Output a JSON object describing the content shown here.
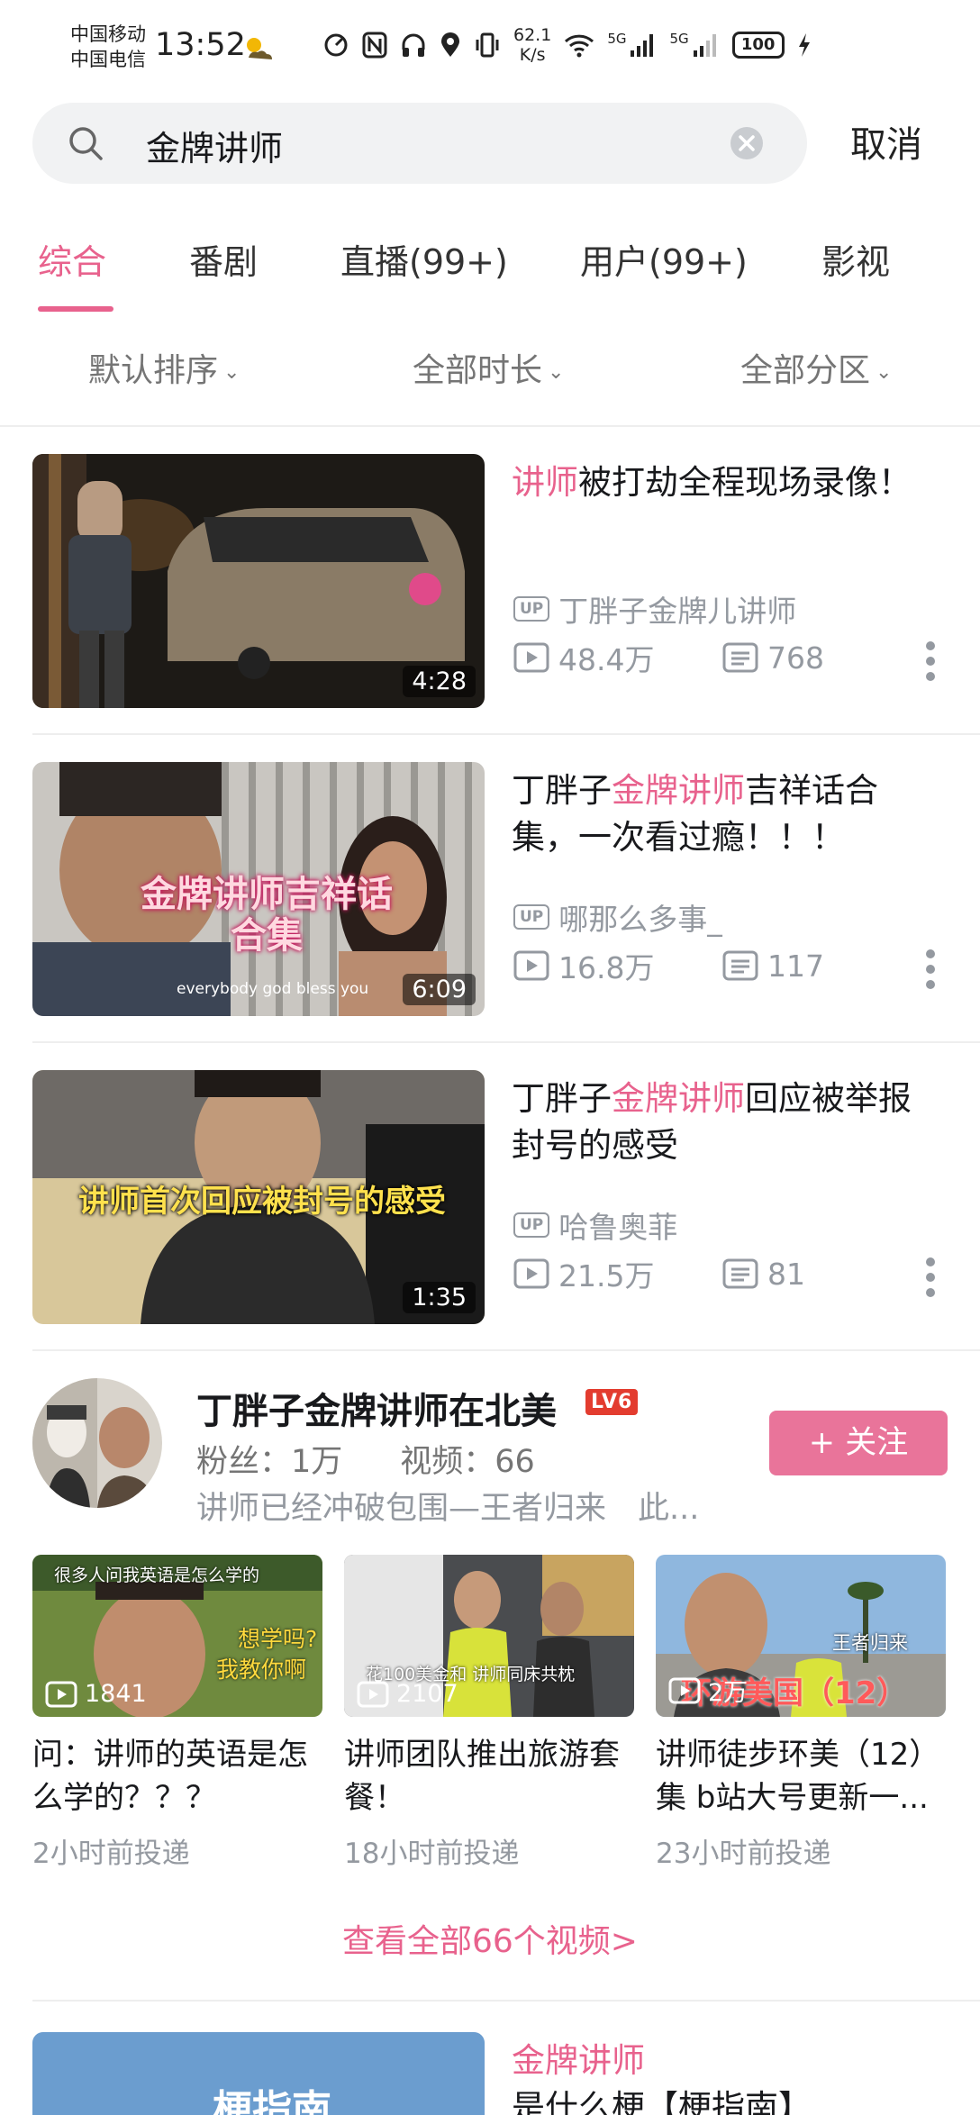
{
  "status_bar": {
    "carrier_1": "中国移动",
    "carrier_2": "中国电信",
    "time": "13:52",
    "net_speed_value": "62.1",
    "net_speed_unit": "K/s",
    "signal_1_label": "5G",
    "signal_2_label": "5G",
    "battery": "100"
  },
  "search": {
    "query": "金牌讲师",
    "cancel_label": "取消"
  },
  "tabs": [
    "综合",
    "番剧",
    "直播(99+)",
    "用户(99+)",
    "影视"
  ],
  "filters": [
    "默认排序",
    "全部时长",
    "全部分区"
  ],
  "videos": [
    {
      "title_hl": "讲师",
      "title_rest": "被打劫全程现场录像！",
      "uploader": "丁胖子金牌儿讲师",
      "plays": "48.4万",
      "comments": "768",
      "duration": "4:28"
    },
    {
      "title_pre": "丁胖子",
      "title_hl": "金牌讲师",
      "title_rest": "吉祥话合集，一次看过瘾！！！",
      "uploader": "哪那么多事_",
      "plays": "16.8万",
      "comments": "117",
      "duration": "6:09",
      "thumb_text": "金牌讲师吉祥话合集",
      "thumb_subtitle": "everybody god bless you"
    },
    {
      "title_pre": "丁胖子",
      "title_hl": "金牌讲师",
      "title_rest": "回应被举报封号的感受",
      "uploader": "哈鲁奥菲",
      "plays": "21.5万",
      "comments": "81",
      "duration": "1:35",
      "thumb_text": "讲师首次回应被封号的感受"
    }
  ],
  "up_badge": "UP",
  "user_card": {
    "name": "丁胖子金牌讲师在北美",
    "level": "LV6",
    "fans_label": "粉丝：1万",
    "videos_label": "视频：66",
    "desc": "讲师已经冲破包围—王者归来　此...",
    "follow_label": "+ 关注",
    "mini_videos": [
      {
        "plays": "1841",
        "title": "问：讲师的英语是怎么学的？？？",
        "time": "2小时前投递",
        "thumb_text_1": "很多人问我英语是怎么学的",
        "thumb_text_2": "想学吗?",
        "thumb_text_3": "我教你啊"
      },
      {
        "plays": "2107",
        "title": "讲师团队推出旅游套餐！",
        "time": "18小时前投递",
        "thumb_text_1": "花100美金和 讲师同床共枕"
      },
      {
        "plays": "2万",
        "title": "讲师徒步环美（12）集 b站大号更新一...",
        "time": "23小时前投递",
        "thumb_text_1": "王者归来",
        "thumb_text_2": "环游美国（12）"
      }
    ],
    "see_all": "查看全部66个视频>"
  },
  "last_video": {
    "title_hl": "金牌讲师",
    "title_rest": "是什么梗【梗指南】",
    "thumb_text": "梗指南"
  },
  "colors": {
    "accent": "#e8628d",
    "follow_button": "#e9749a",
    "secondary_text": "#9499a0"
  },
  "icons": [
    "search-icon",
    "clear-icon",
    "play-count-icon",
    "comment-count-icon",
    "more-icon",
    "wifi-icon",
    "battery-icon"
  ]
}
